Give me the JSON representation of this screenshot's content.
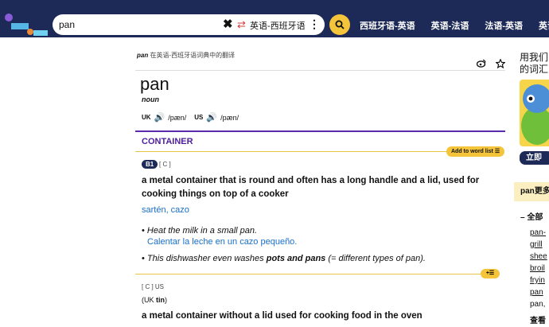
{
  "header": {
    "search_value": "pan",
    "dict_selector": "英语-西班牙语",
    "nav": [
      "西班牙语-英语",
      "英语-法语",
      "法语-英语",
      "英语"
    ]
  },
  "colors": {
    "header_bg": "#1d2a57",
    "accent": "#f4c43b",
    "purple": "#5b2bad",
    "link": "#1a6fc9"
  },
  "entry": {
    "breadcrumb_word": "pan",
    "breadcrumb_rest": " 在英语-西班牙语词典中的翻译",
    "headword": "pan",
    "pos": "noun",
    "uk_label": "UK",
    "uk_ipa": "/pæn/",
    "us_label": "US",
    "us_ipa": "/pæn/",
    "sense_title": "CONTAINER",
    "wordlist_label": "Add to word list",
    "level": "B1",
    "gram": "[ C ]",
    "definition": "a metal container that is round and often has a long handle and a lid, used for cooking things on top of a cooker",
    "translation": "sartén, cazo",
    "examples": [
      {
        "en": "Heat the milk in a small pan.",
        "es": "Calentar la leche en un cazo pequeño."
      },
      {
        "en": "This dishwasher even washes pots and pans (= different types of pan).",
        "es": ""
      }
    ],
    "gram2": "[ C ] US",
    "uk_variant": "(UK tin)",
    "definition2": "a metal container without a lid used for cooking food in the oven"
  },
  "sidebar": {
    "ad_line1": "用我们",
    "ad_line2": "的词汇",
    "ad_button": "立即",
    "more_title": "pan更多",
    "all_label": "全部",
    "links": [
      "pan-",
      "grill",
      "shee",
      "broil",
      "fryin",
      "pan",
      "pan,"
    ],
    "see_more": "查看"
  }
}
